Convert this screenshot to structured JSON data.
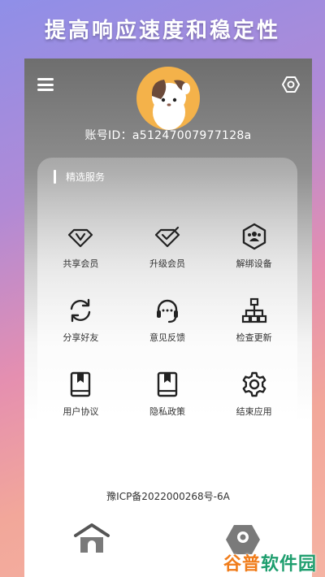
{
  "banner": {
    "title": "提高响应速度和稳定性"
  },
  "header": {
    "menu_icon": "hamburger-menu-icon",
    "settings_icon": "hexagon-settings-icon",
    "account_label": "账号ID：a51247007977128a"
  },
  "services": {
    "title": "精选服务",
    "items": [
      {
        "label": "共享会员",
        "icon": "diamond-v-icon"
      },
      {
        "label": "升级会员",
        "icon": "diamond-check-icon"
      },
      {
        "label": "解绑设备",
        "icon": "users-hexagon-icon"
      },
      {
        "label": "分享好友",
        "icon": "refresh-arrows-icon"
      },
      {
        "label": "意见反馈",
        "icon": "headset-icon"
      },
      {
        "label": "检查更新",
        "icon": "network-tree-icon"
      },
      {
        "label": "用户协议",
        "icon": "bookmark-book-icon"
      },
      {
        "label": "隐私政策",
        "icon": "bookmark-book-icon"
      },
      {
        "label": "结束应用",
        "icon": "gear-icon"
      }
    ]
  },
  "footer": {
    "icp": "豫ICP备2022000268号-6A"
  },
  "tabbar": {
    "home_icon": "home-icon",
    "mine_icon": "profile-hexagon-icon"
  },
  "watermark": {
    "part1": "谷普",
    "part2": "软件园"
  },
  "colors": {
    "accent": "#222222",
    "watermark_green": "#1e9e6e",
    "watermark_orange": "#f07c1a"
  }
}
